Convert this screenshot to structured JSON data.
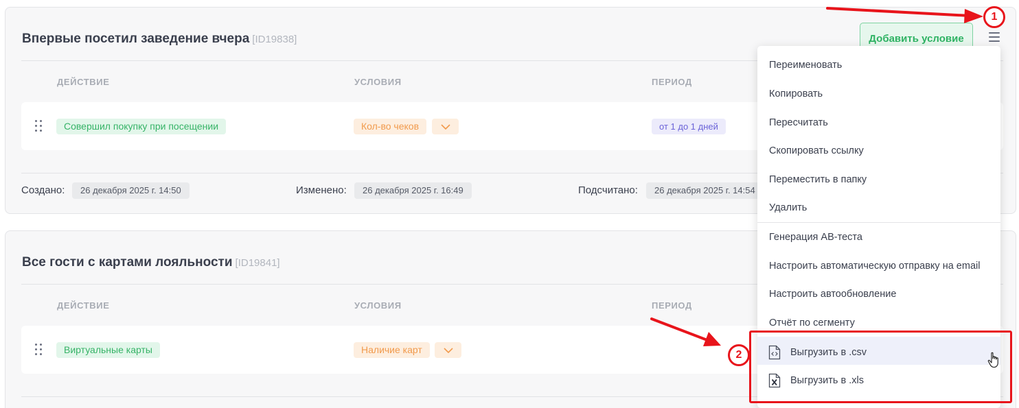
{
  "segments": [
    {
      "title": "Впервые посетил заведение вчера",
      "id_label": "[ID19838]",
      "columns": [
        "ДЕЙСТВИЕ",
        "УСЛОВИЯ",
        "ПЕРИОД"
      ],
      "row": {
        "action": "Совершил покупку при посещении",
        "condition": "Кол-во чеков",
        "period": "от 1 до 1 дней"
      },
      "meta": {
        "created_label": "Создано:",
        "created_value": "26 декабря 2025 г. 14:50",
        "modified_label": "Изменено:",
        "modified_value": "26 декабря 2025 г. 16:49",
        "counted_label": "Подсчитано:",
        "counted_value": "26 декабря 2025 г. 14:54"
      }
    },
    {
      "title": "Все гости с картами лояльности",
      "id_label": "[ID19841]",
      "columns": [
        "ДЕЙСТВИЕ",
        "УСЛОВИЯ",
        "ПЕРИОД"
      ],
      "row": {
        "action": "Виртуальные карты",
        "condition": "Наличие карт"
      }
    }
  ],
  "toolbar": {
    "add_condition_label": "Добавить условие",
    "menu_icon": "hamburger-menu-icon"
  },
  "context_menu": {
    "items": [
      "Переименовать",
      "Копировать",
      "Пересчитать",
      "Скопировать ссылку",
      "Переместить в папку",
      "Удалить",
      "Генерация АВ-теста",
      "Настроить автоматическую отправку на email",
      "Настроить автообновление",
      "Отчёт по сегменту"
    ],
    "export_items": [
      "Выгрузить в .csv",
      "Выгрузить в .xls"
    ]
  },
  "annotations": {
    "badge_1": "1",
    "badge_2": "2",
    "color": "#e8141b"
  },
  "colors": {
    "green_tag_bg": "#e2f6ea",
    "green_tag_text": "#36b367",
    "orange_tag_bg": "#fdeedf",
    "orange_tag_text": "#f19a4c",
    "violet_tag_bg": "#ecebfb",
    "violet_tag_text": "#6b63d8",
    "highlight_bg": "#eef0fa"
  }
}
